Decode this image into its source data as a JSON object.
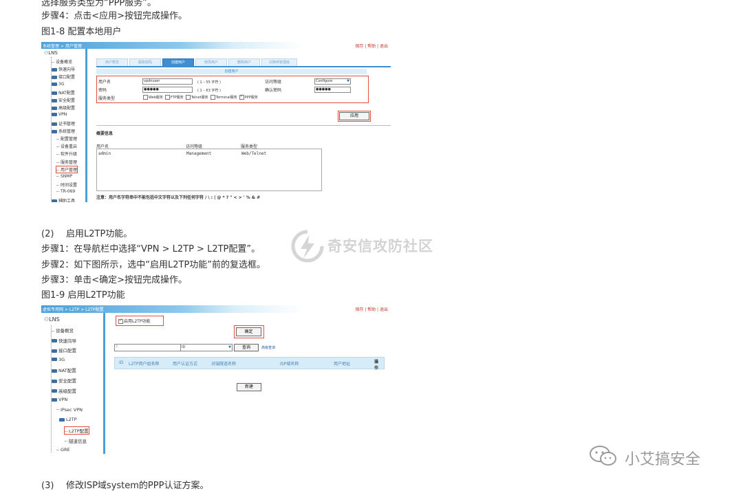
{
  "doc": {
    "top_cut": "选择服务类型为“PPP服务”。",
    "step4": "步骤4：点击<应用>按钮完成操作。",
    "fig18_caption": "图1-8 配置本地用户",
    "sec2_num": "(2)",
    "sec2_text": "启用L2TP功能。",
    "step1": "步骤1：在导航栏中选择“VPN > L2TP > L2TP配置”。",
    "step2": "步骤2：如下图所示，选中“启用L2TP功能”前的复选框。",
    "step3": "步骤3：单击<确定>按钮完成操作。",
    "fig19_caption": "图1-9 启用L2TP功能",
    "sec3_num": "(3)",
    "sec3_text": "修改ISP域system的PPP认证方案。"
  },
  "watermarks": {
    "center": "奇安信攻防社区",
    "bottom": "小艾搞安全"
  },
  "fig18": {
    "breadcrumb": "系统管理 > 用户管理",
    "links": "保存 | 帮助 | 退出",
    "tree_root": "LNS",
    "tree": [
      {
        "label": "设备概览",
        "type": "leaf"
      },
      {
        "label": "快速向导",
        "type": "folder"
      },
      {
        "label": "接口配置",
        "type": "folder"
      },
      {
        "label": "3G",
        "type": "folder"
      },
      {
        "label": "NAT配置",
        "type": "folder"
      },
      {
        "label": "安全配置",
        "type": "folder"
      },
      {
        "label": "高级配置",
        "type": "folder"
      },
      {
        "label": "VPN",
        "type": "folder"
      },
      {
        "label": "证书管理",
        "type": "folder"
      },
      {
        "label": "系统管理",
        "type": "folder"
      },
      {
        "label": "配置管理",
        "type": "sub"
      },
      {
        "label": "设备重启",
        "type": "sub"
      },
      {
        "label": "软件升级",
        "type": "sub"
      },
      {
        "label": "服务管理",
        "type": "sub"
      },
      {
        "label": "用户管理",
        "type": "sub",
        "selected": true
      },
      {
        "label": "SNMP",
        "type": "sub"
      },
      {
        "label": "时间设置",
        "type": "sub"
      },
      {
        "label": "TR-069",
        "type": "sub"
      },
      {
        "label": "辅助工具",
        "type": "folder"
      }
    ],
    "tabs": [
      "用户概览",
      "超级密码",
      "创建用户",
      "修改用户",
      "删除用户",
      "切换到管理级"
    ],
    "active_tab": 2,
    "form_title": "创建用户",
    "form": {
      "username_label": "用户名",
      "username_value": "vpdnuser",
      "username_hint": "( 1 – 55 字符 )",
      "level_label": "访问等级",
      "level_value": "Configure",
      "password_label": "密码",
      "password_value": "●●●●●",
      "password_hint": "( 1 – 63 字符 )",
      "confirm_label": "确认密码",
      "confirm_value": "●●●●●",
      "service_label": "服务类型",
      "services": [
        {
          "label": "Web服务",
          "checked": false
        },
        {
          "label": "FTP服务",
          "checked": false
        },
        {
          "label": "Telnet服务",
          "checked": false
        },
        {
          "label": "Terminal服务",
          "checked": false
        },
        {
          "label": "PPP服务",
          "checked": true
        }
      ]
    },
    "apply_label": "应用",
    "summary_title": "概要信息",
    "summary_headers": [
      "用户名",
      "访问等级",
      "服务类型"
    ],
    "summary_rows": [
      [
        "admin",
        "Management",
        "Web/Telnet"
      ]
    ],
    "note": "注意：用户名字符串中不能包括中文字符以及下列任何字符  /  \\  :  |  @  *  ?  \"  <  >  '  %  &  #"
  },
  "fig19": {
    "breadcrumb": "虚拟专用网 > L2TP > L2TP配置",
    "links": "保存 | 帮助 | 退出",
    "tree_root": "LNS",
    "tree": [
      {
        "label": "设备概览",
        "type": "leaf"
      },
      {
        "label": "快速向导",
        "type": "folder"
      },
      {
        "label": "接口配置",
        "type": "folder"
      },
      {
        "label": "3G",
        "type": "folder"
      },
      {
        "label": "NAT配置",
        "type": "folder"
      },
      {
        "label": "安全配置",
        "type": "folder"
      },
      {
        "label": "高级配置",
        "type": "folder"
      },
      {
        "label": "VPN",
        "type": "folder"
      },
      {
        "label": "IPsec VPN",
        "type": "sub"
      },
      {
        "label": "L2TP",
        "type": "subfolder"
      },
      {
        "label": "L2TP配置",
        "type": "sub2",
        "selected": true
      },
      {
        "label": "隧道信息",
        "type": "sub2"
      },
      {
        "label": "GRE",
        "type": "sub"
      }
    ],
    "enable_label": "启用L2TP功能",
    "enable_checked": true,
    "ok_label": "确定",
    "search_select": "ID",
    "search_button": "查询",
    "adv_search": "高级查询",
    "table_headers": [
      "ID",
      "L2TP用户组名称",
      "用户认证方式",
      "对端隧道名称",
      "ISP域名称",
      "用户地址",
      "操作"
    ],
    "new_label": "新建"
  }
}
